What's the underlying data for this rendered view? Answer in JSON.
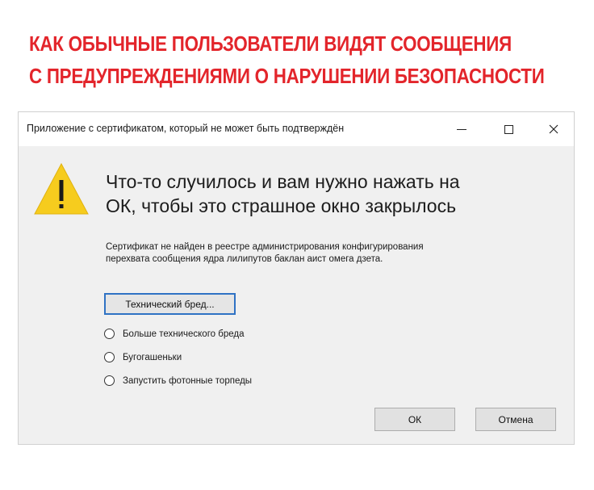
{
  "headline": {
    "line1": "КАК ОБЫЧНЫЕ ПОЛЬЗОВАТЕЛИ ВИДЯТ СООБЩЕНИЯ",
    "line2": "С ПРЕДУПРЕЖДЕНИЯМИ О НАРУШЕНИИ БЕЗОПАСНОСТИ",
    "color": "#e3252b"
  },
  "dialog": {
    "title": "Приложение с сертификатом, который не может быть подтверждён",
    "controls": {
      "minimize": "–",
      "close": "✕"
    },
    "icon": "warning-triangle-icon",
    "main_instruction": {
      "line1": "Что-то случилось и вам нужно нажать на",
      "line2": "ОК, чтобы это страшное окно закрылось"
    },
    "content": {
      "line1": "Сертификат не найден в реестре администрирования конфигурирования",
      "line2": "перехвата сообщения ядра лилипутов баклан аист омега дзета."
    },
    "details_button": "Технический бред...",
    "radio_options": [
      "Больше технического бреда",
      "Бугогашеньки",
      "Запустить фотонные торпеды"
    ],
    "ok_button": "ОК",
    "cancel_button": "Отмена"
  }
}
